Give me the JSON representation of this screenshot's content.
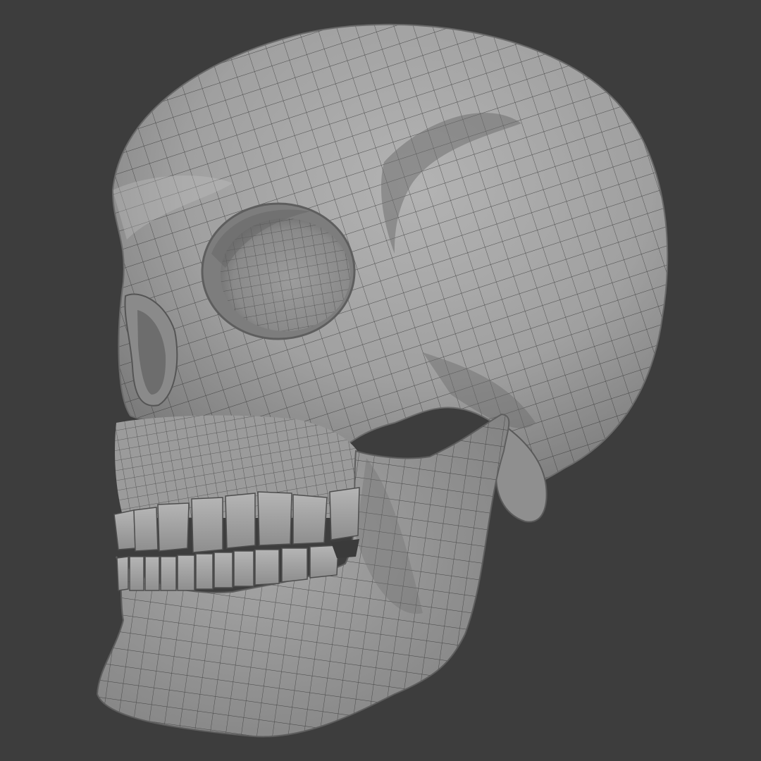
{
  "scene": {
    "subject": "skull-wireframe-render",
    "background_color": "#3d3d3d",
    "mesh_color": "#9a9a9a",
    "wire_color": "#2a2a2a"
  }
}
